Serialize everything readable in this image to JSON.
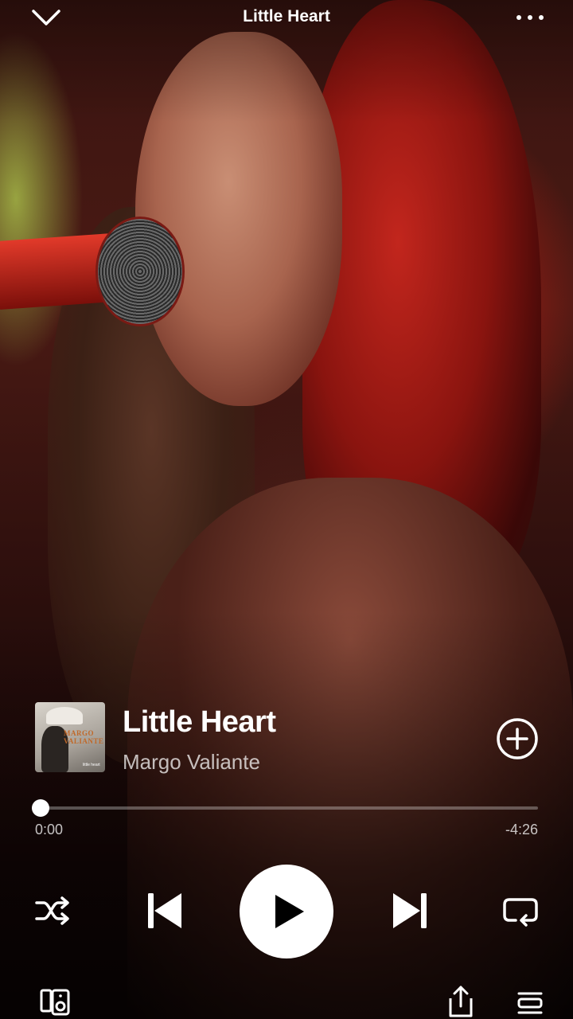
{
  "header": {
    "title": "Little Heart",
    "collapse_icon": "chevron-down-icon",
    "more_icon": "more-horizontal-icon"
  },
  "track": {
    "title": "Little Heart",
    "artist": "Margo Valiante",
    "cover_text_line1": "MARGO",
    "cover_text_line2": "VALIANTE",
    "cover_small_text": "little heart",
    "add_icon": "add-circle-icon"
  },
  "progress": {
    "elapsed": "0:00",
    "remaining": "-4:26",
    "fraction": 0.0
  },
  "controls": {
    "shuffle_icon": "shuffle-icon",
    "previous_icon": "skip-previous-icon",
    "play_icon": "play-icon",
    "next_icon": "skip-next-icon",
    "repeat_icon": "repeat-icon"
  },
  "footer": {
    "device_icon": "connect-device-icon",
    "share_icon": "share-icon",
    "queue_icon": "queue-icon"
  },
  "colors": {
    "accent": "#ffffff",
    "secondary_text": "#b8b8b8"
  }
}
